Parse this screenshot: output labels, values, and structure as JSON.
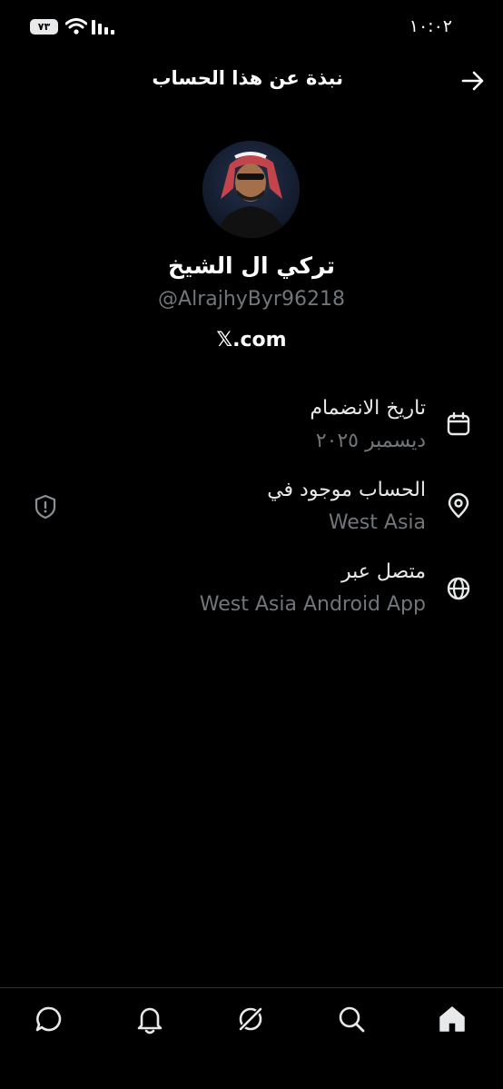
{
  "status_bar": {
    "time": "١٠:٠٢",
    "battery": "٧٣"
  },
  "header": {
    "title": "نبذة عن هذا الحساب"
  },
  "profile": {
    "display_name": "تركي ال الشيخ",
    "handle": "@AlrajhyByr96218",
    "link_text": "𝕏.com"
  },
  "rows": [
    {
      "icon": "calendar-icon",
      "label": "تاريخ الانضمام",
      "value": "ديسمبر ٢٠٢٥"
    },
    {
      "icon": "location-pin-icon",
      "label": "الحساب موجود في",
      "value": "West Asia",
      "badge_icon": "shield-icon"
    },
    {
      "icon": "globe-icon",
      "label": "متصل عبر",
      "value": "West Asia Android App"
    }
  ],
  "bottom_nav": [
    {
      "icon": "home-icon",
      "active": true
    },
    {
      "icon": "search-icon"
    },
    {
      "icon": "grok-icon"
    },
    {
      "icon": "notifications-icon"
    },
    {
      "icon": "messages-icon"
    }
  ],
  "colors": {
    "background": "#000000",
    "text_primary": "#e7e9ea",
    "text_secondary": "#71767b",
    "divider": "#2f3336"
  }
}
